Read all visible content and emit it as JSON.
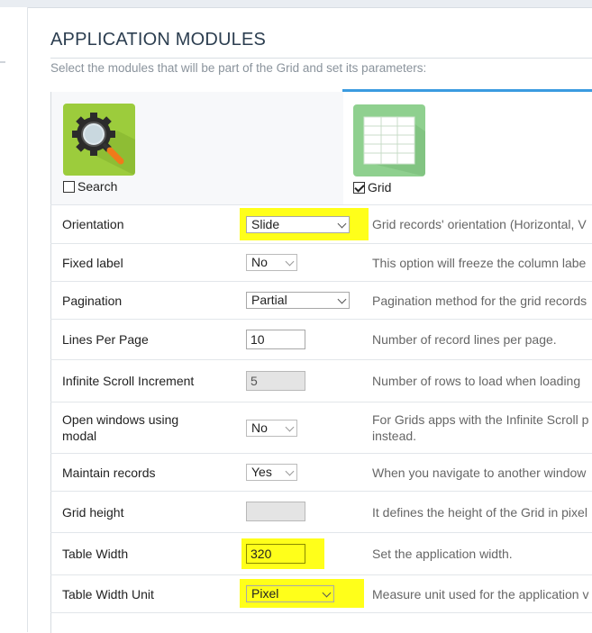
{
  "page": {
    "title": "APPLICATION MODULES",
    "subtitle": "Select the modules that will be part of the Grid and set its parameters:"
  },
  "modules": [
    {
      "name": "Search",
      "checked": false,
      "icon": "search-gear-icon",
      "color": "#9ccc3c"
    },
    {
      "name": "Grid",
      "checked": true,
      "icon": "grid-table-icon",
      "color": "#8fd08f"
    }
  ],
  "highlight_color": "#ffff1a",
  "accent_color": "#3b9be0",
  "settings": [
    {
      "label": "Orientation",
      "control": "select",
      "value": "Slide",
      "highlighted": true,
      "description": "Grid records' orientation (Horizontal, V"
    },
    {
      "label": "Fixed label",
      "control": "select",
      "value": "No",
      "highlighted": false,
      "description": "This option will freeze the column labe"
    },
    {
      "label": "Pagination",
      "control": "select",
      "value": "Partial",
      "highlighted": false,
      "description": "Pagination method for the grid records"
    },
    {
      "label": "Lines Per Page",
      "control": "input",
      "value": "10",
      "highlighted": false,
      "description": "Number of record lines per page."
    },
    {
      "label": "Infinite Scroll Increment",
      "control": "input-disabled",
      "value": "5",
      "highlighted": false,
      "description": "Number of rows to load when loading"
    },
    {
      "label_line1": "Open windows using",
      "label_line2": "modal",
      "control": "select",
      "value": "No",
      "highlighted": false,
      "description_line1": "For Grids apps with the Infinite Scroll p",
      "description_line2": "instead."
    },
    {
      "label": "Maintain records",
      "control": "select",
      "value": "Yes",
      "highlighted": false,
      "description": "When you navigate to another window"
    },
    {
      "label": "Grid height",
      "control": "input-disabled",
      "value": "",
      "highlighted": false,
      "description": "It defines the height of the Grid in pixel"
    },
    {
      "label": "Table Width",
      "control": "input",
      "value": "320",
      "highlighted": true,
      "description": "Set the application width."
    },
    {
      "label": "Table Width Unit",
      "control": "select",
      "value": "Pixel",
      "highlighted": true,
      "description": "Measure unit used for the application v"
    }
  ]
}
